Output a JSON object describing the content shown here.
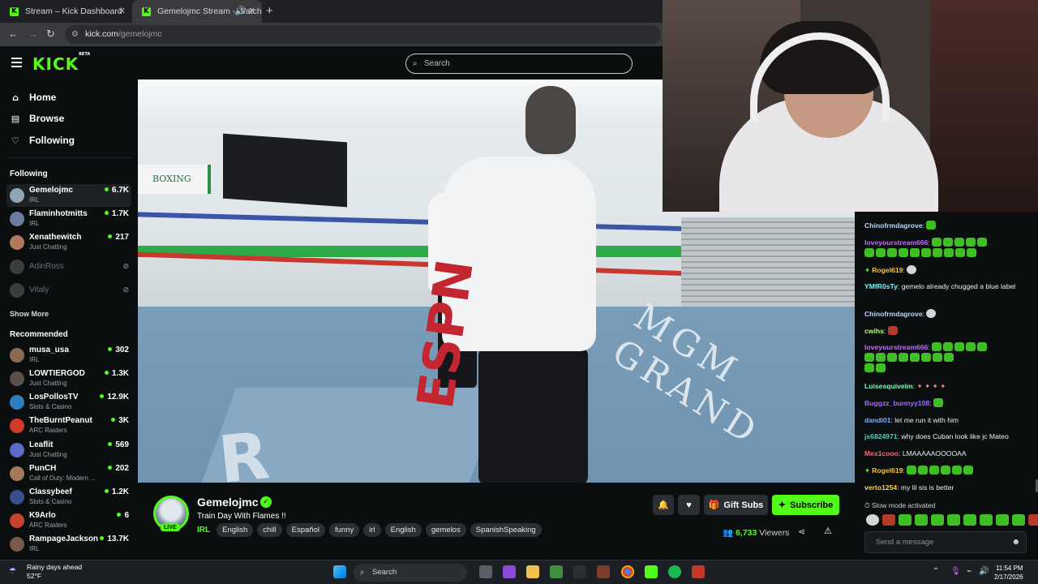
{
  "browser": {
    "tabs": [
      {
        "title": "Stream – Kick Dashboard",
        "active": false
      },
      {
        "title": "Gemelojmc Stream - Watch",
        "active": true
      }
    ],
    "url_host": "kick.com",
    "url_path": "/gemelojmc"
  },
  "header": {
    "logo": "KICK",
    "logo_badge": "BETA",
    "search_placeholder": "Search"
  },
  "sidebar": {
    "nav": [
      {
        "label": "Home",
        "icon": "home-icon"
      },
      {
        "label": "Browse",
        "icon": "browse-icon"
      },
      {
        "label": "Following",
        "icon": "heart-icon"
      }
    ],
    "following_header": "Following",
    "following": [
      {
        "name": "Gemelojmc",
        "category": "IRL",
        "viewers": "6.7K",
        "live": true,
        "avatar_color": "#8fa7b8"
      },
      {
        "name": "Flaminhotmitts",
        "category": "IRL",
        "viewers": "1.7K",
        "live": true,
        "avatar_color": "#6c7ea0"
      },
      {
        "name": "Xenathewitch",
        "category": "Just Chatting",
        "viewers": "217",
        "live": true,
        "avatar_color": "#b07a5a"
      },
      {
        "name": "AdinRoss",
        "category": "",
        "viewers": "",
        "live": false,
        "avatar_color": "#777777"
      },
      {
        "name": "Vitaly",
        "category": "",
        "viewers": "",
        "live": false,
        "avatar_color": "#777777"
      }
    ],
    "show_more": "Show More",
    "recommended_header": "Recommended",
    "recommended": [
      {
        "name": "musa_usa",
        "category": "IRL",
        "viewers": "302",
        "avatar_color": "#8c6b55"
      },
      {
        "name": "LOWTIERGOD",
        "category": "Just Chatting",
        "viewers": "1.3K",
        "avatar_color": "#5a4f4a"
      },
      {
        "name": "LosPollosTV",
        "category": "Slots & Casino",
        "viewers": "12.9K",
        "avatar_color": "#2e7ec0"
      },
      {
        "name": "TheBurntPeanut",
        "category": "ARC Raiders",
        "viewers": "3K",
        "avatar_color": "#d23b2b"
      },
      {
        "name": "Leaflit",
        "category": "Just Chatting",
        "viewers": "569",
        "avatar_color": "#5a6cc8"
      },
      {
        "name": "PunCH",
        "category": "Call of Duty: Modern ...",
        "viewers": "202",
        "avatar_color": "#a57a5c"
      },
      {
        "name": "Classybeef",
        "category": "Slots & Casino",
        "viewers": "1.2K",
        "avatar_color": "#3a4f8a"
      },
      {
        "name": "K9Arlo",
        "category": "ARC Raiders",
        "viewers": "6",
        "avatar_color": "#c4422e"
      },
      {
        "name": "RampageJackson",
        "category": "IRL",
        "viewers": "13.7K",
        "avatar_color": "#7a5a4a"
      }
    ]
  },
  "stream": {
    "channel": "Gemelojmc",
    "live_badge": "LIVE",
    "title": "Train Day With Flames !!",
    "category": "IRL",
    "tags": [
      "English",
      "chill",
      "Español",
      "funny",
      "irl",
      "English",
      "gemelos",
      "SpanishSpeaking"
    ],
    "gift_label": "Gift Subs",
    "subscribe_label": "Subscribe",
    "viewer_count": "6,733",
    "viewers_label": "Viewers",
    "video_overlay": {
      "espn": "ESPN",
      "mgm": "MGM GRAND",
      "boxing": "BOXING",
      "ring": "R"
    }
  },
  "chat": {
    "messages": [
      {
        "user": "Chinofrmdagrove",
        "color": "#b9d7ff",
        "text": "",
        "emotes": 1
      },
      {
        "user": "loveyourstream666",
        "color": "#c46bff",
        "text": "",
        "emotes": 6
      },
      {
        "user": "Rogel619",
        "color": "#f5c542",
        "text": "",
        "emotes": 1,
        "badge": true
      },
      {
        "user": "YMfR0sTy",
        "color": "#7ff0ff",
        "text": "gemelo already chugged a blue label"
      },
      {
        "user": "Chinofrmdagrove",
        "color": "#b9d7ff",
        "text": "",
        "emotes": 1
      },
      {
        "user": "cwihs",
        "color": "#b6ff7a",
        "text": "",
        "emotes": 1
      },
      {
        "user": "loveyourstream666",
        "color": "#c46bff",
        "text": "",
        "emotes": 10
      },
      {
        "user": "Luisesquivelm",
        "color": "#7affc2",
        "text": "",
        "emotes": 4
      },
      {
        "user": "Buggzz_bunnyy108",
        "color": "#a66bff",
        "text": "",
        "emotes": 1
      },
      {
        "user": "dandi01",
        "color": "#7ab0ff",
        "text": "let me run it with him"
      },
      {
        "user": "js6824971",
        "color": "#4cd0c5",
        "text": "why does Cuban look like jc Mateo"
      },
      {
        "user": "Mex1cooo",
        "color": "#ff6b6b",
        "text": "LMAAAAAOOOOAA"
      },
      {
        "user": "Rogel619",
        "color": "#f5c542",
        "text": "",
        "emotes": 6,
        "badge": true
      },
      {
        "user": "verto1254",
        "color": "#ffd24c",
        "text": "my lil sis is better"
      }
    ],
    "slow_mode": "Slow mode activated",
    "input_placeholder": "Send a message"
  },
  "taskbar": {
    "weather_title": "Rainy days ahead",
    "weather_temp": "52°F",
    "search_label": "Search",
    "time": "11:54 PM",
    "date": "2/17/2026"
  },
  "colors": {
    "brand": "#53fc18",
    "bg": "#0b0e0f",
    "chip": "#2b2f33"
  }
}
